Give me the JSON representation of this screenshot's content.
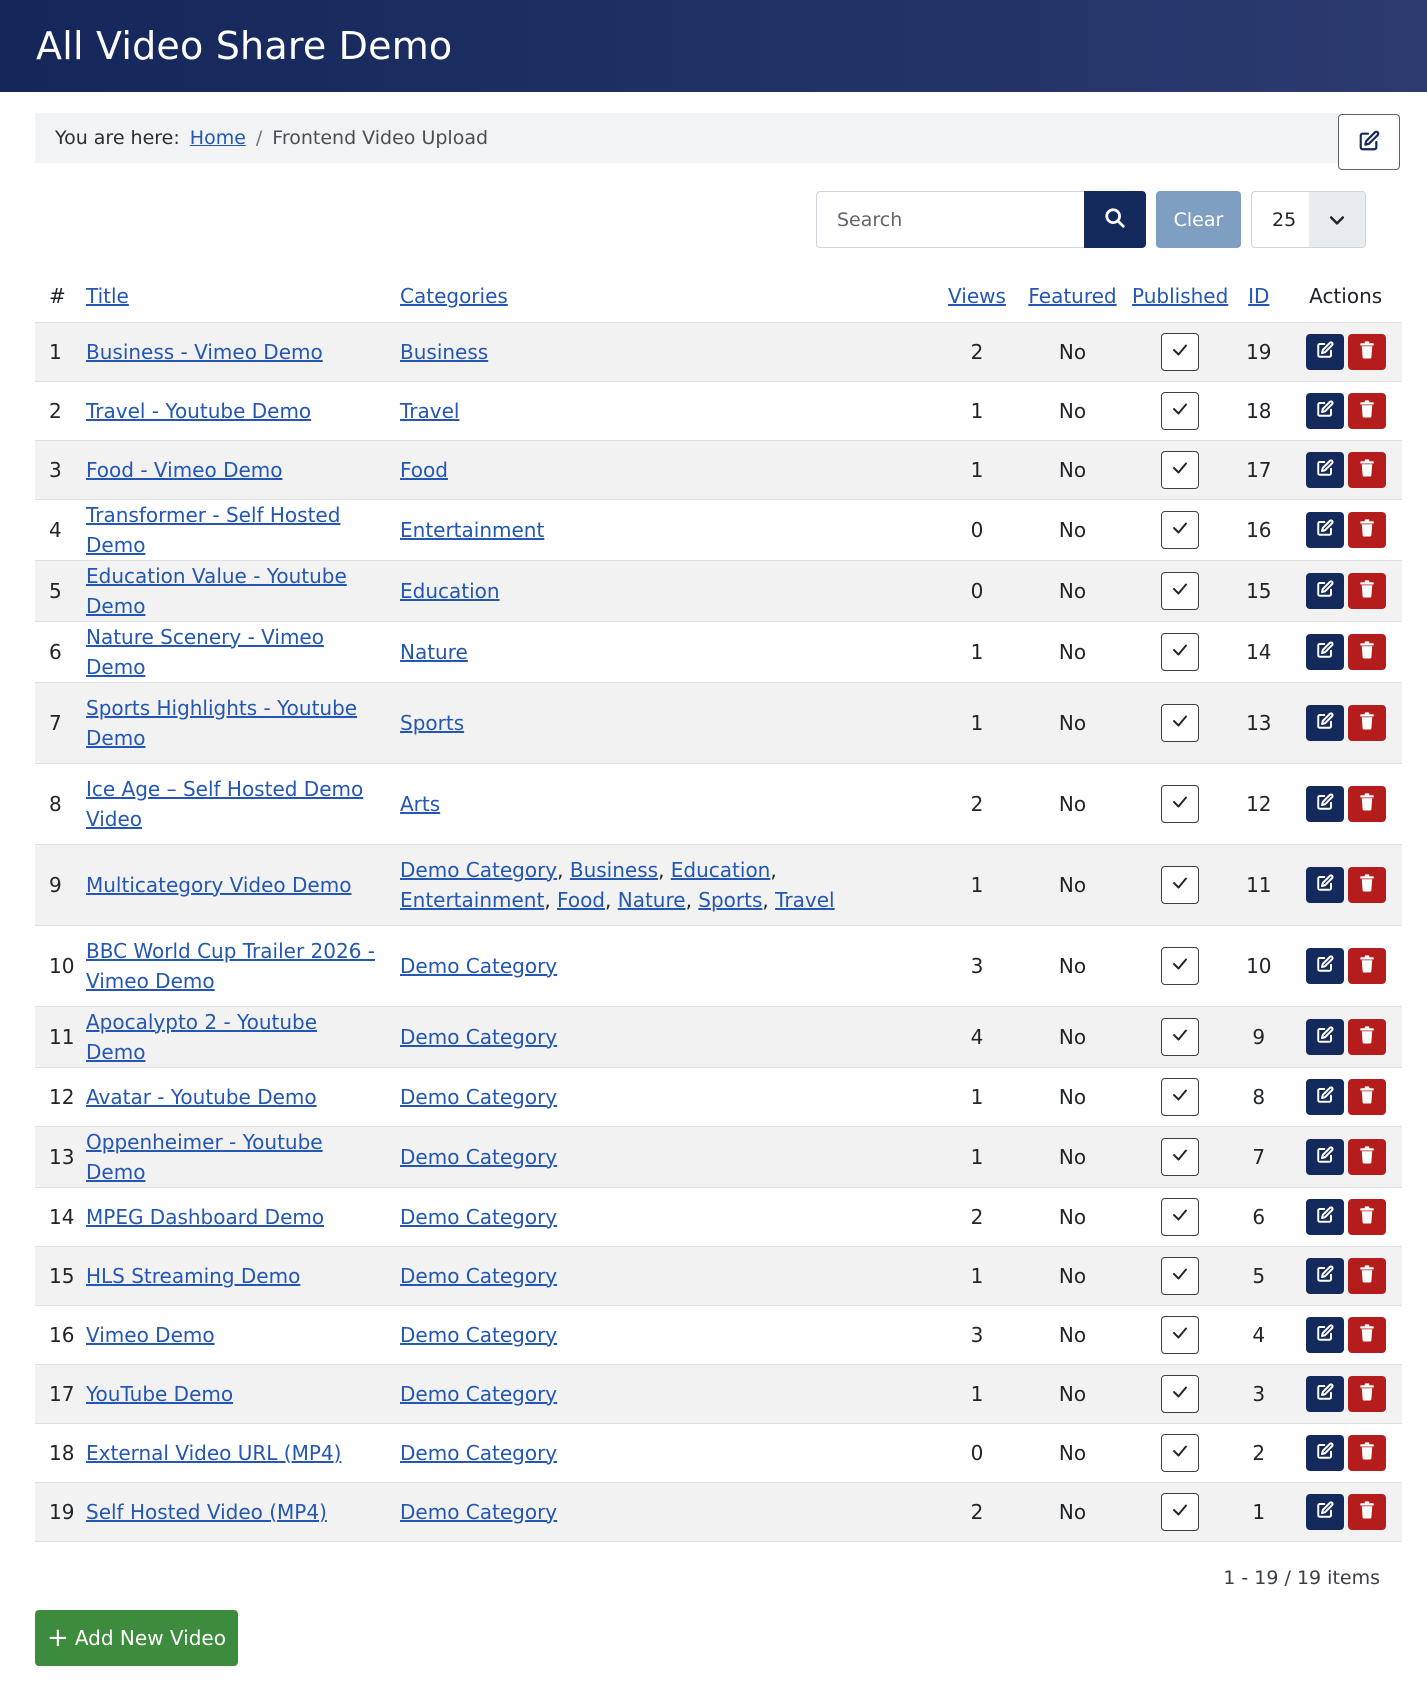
{
  "site": {
    "title": "All Video Share Demo"
  },
  "breadcrumb": {
    "prefix": "You are here:",
    "home": "Home",
    "separator": "/",
    "current": "Frontend Video Upload"
  },
  "toolbar": {
    "search_placeholder": "Search",
    "search_value": "",
    "clear_label": "Clear",
    "limit_value": "25"
  },
  "table": {
    "headers": {
      "num": "#",
      "title": "Title",
      "categories": "Categories",
      "views": "Views",
      "featured": "Featured",
      "published": "Published",
      "id": "ID",
      "actions": "Actions"
    },
    "rows": [
      {
        "num": "1",
        "title": "Business - Vimeo Demo",
        "categories": [
          "Business"
        ],
        "views": "2",
        "featured": "No",
        "published": true,
        "id": "19",
        "tall": false
      },
      {
        "num": "2",
        "title": "Travel - Youtube Demo",
        "categories": [
          "Travel"
        ],
        "views": "1",
        "featured": "No",
        "published": true,
        "id": "18",
        "tall": false
      },
      {
        "num": "3",
        "title": "Food - Vimeo Demo",
        "categories": [
          "Food"
        ],
        "views": "1",
        "featured": "No",
        "published": true,
        "id": "17",
        "tall": false
      },
      {
        "num": "4",
        "title": "Transformer - Self Hosted Demo",
        "categories": [
          "Entertainment"
        ],
        "views": "0",
        "featured": "No",
        "published": true,
        "id": "16",
        "tall": false
      },
      {
        "num": "5",
        "title": "Education Value - Youtube Demo",
        "categories": [
          "Education"
        ],
        "views": "0",
        "featured": "No",
        "published": true,
        "id": "15",
        "tall": false
      },
      {
        "num": "6",
        "title": "Nature Scenery - Vimeo Demo",
        "categories": [
          "Nature"
        ],
        "views": "1",
        "featured": "No",
        "published": true,
        "id": "14",
        "tall": false
      },
      {
        "num": "7",
        "title": "Sports Highlights - Youtube Demo",
        "categories": [
          "Sports"
        ],
        "views": "1",
        "featured": "No",
        "published": true,
        "id": "13",
        "tall": true
      },
      {
        "num": "8",
        "title": "Ice Age – Self Hosted Demo Video",
        "categories": [
          "Arts"
        ],
        "views": "2",
        "featured": "No",
        "published": true,
        "id": "12",
        "tall": true
      },
      {
        "num": "9",
        "title": "Multicategory Video Demo",
        "categories": [
          "Demo Category",
          "Business",
          "Education",
          "Entertainment",
          "Food",
          "Nature",
          "Sports",
          "Travel"
        ],
        "views": "1",
        "featured": "No",
        "published": true,
        "id": "11",
        "tall": true
      },
      {
        "num": "10",
        "title": "BBC World Cup Trailer 2026 - Vimeo Demo",
        "categories": [
          "Demo Category"
        ],
        "views": "3",
        "featured": "No",
        "published": true,
        "id": "10",
        "tall": true
      },
      {
        "num": "11",
        "title": "Apocalypto 2 - Youtube Demo",
        "categories": [
          "Demo Category"
        ],
        "views": "4",
        "featured": "No",
        "published": true,
        "id": "9",
        "tall": false
      },
      {
        "num": "12",
        "title": "Avatar - Youtube Demo",
        "categories": [
          "Demo Category"
        ],
        "views": "1",
        "featured": "No",
        "published": true,
        "id": "8",
        "tall": false
      },
      {
        "num": "13",
        "title": "Oppenheimer - Youtube Demo",
        "categories": [
          "Demo Category"
        ],
        "views": "1",
        "featured": "No",
        "published": true,
        "id": "7",
        "tall": false
      },
      {
        "num": "14",
        "title": "MPEG Dashboard Demo",
        "categories": [
          "Demo Category"
        ],
        "views": "2",
        "featured": "No",
        "published": true,
        "id": "6",
        "tall": false
      },
      {
        "num": "15",
        "title": "HLS Streaming Demo",
        "categories": [
          "Demo Category"
        ],
        "views": "1",
        "featured": "No",
        "published": true,
        "id": "5",
        "tall": false
      },
      {
        "num": "16",
        "title": "Vimeo Demo",
        "categories": [
          "Demo Category"
        ],
        "views": "3",
        "featured": "No",
        "published": true,
        "id": "4",
        "tall": false
      },
      {
        "num": "17",
        "title": "YouTube Demo",
        "categories": [
          "Demo Category"
        ],
        "views": "1",
        "featured": "No",
        "published": true,
        "id": "3",
        "tall": false
      },
      {
        "num": "18",
        "title": "External Video URL (MP4)",
        "categories": [
          "Demo Category"
        ],
        "views": "0",
        "featured": "No",
        "published": true,
        "id": "2",
        "tall": false
      },
      {
        "num": "19",
        "title": "Self Hosted Video (MP4)",
        "categories": [
          "Demo Category"
        ],
        "views": "2",
        "featured": "No",
        "published": true,
        "id": "1",
        "tall": false
      }
    ]
  },
  "pagination": {
    "info": "1 - 19 / 19 items"
  },
  "footer": {
    "add_label": "Add New Video",
    "add_icon": "plus-icon"
  },
  "icons": {
    "page_edit": "edit-icon",
    "search": "search-icon",
    "limit_caret": "chevron-down-icon",
    "check": "check-icon",
    "row_edit": "edit-icon",
    "row_delete": "trash-icon"
  },
  "colors": {
    "header_bg": "#1e3064",
    "primary": "#142a5c",
    "danger": "#b51c1c",
    "success": "#3d8b3d",
    "clear": "#7f9fc2",
    "link": "#2457b3"
  }
}
